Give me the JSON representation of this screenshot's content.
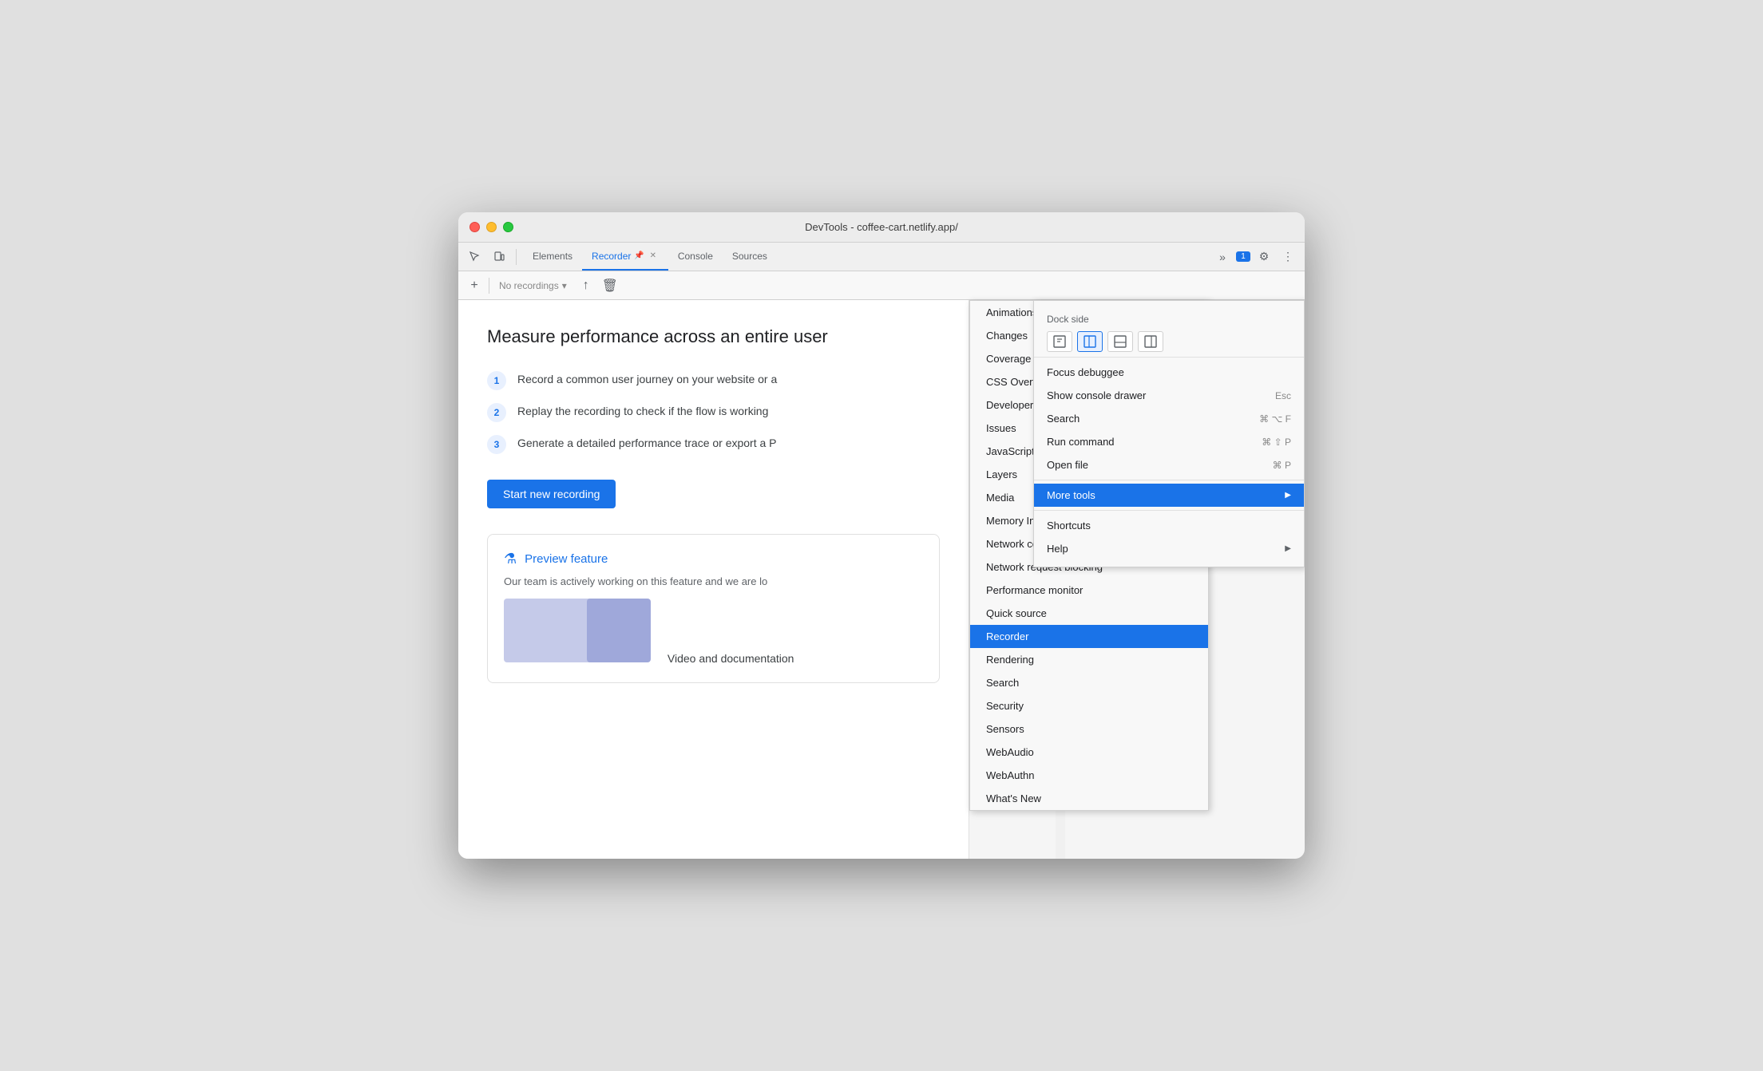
{
  "window": {
    "title": "DevTools - coffee-cart.netlify.app/"
  },
  "traffic_lights": {
    "red_label": "close",
    "yellow_label": "minimize",
    "green_label": "maximize"
  },
  "toolbar": {
    "tabs": [
      {
        "id": "elements",
        "label": "Elements",
        "active": false
      },
      {
        "id": "recorder",
        "label": "Recorder",
        "active": true,
        "has_pin": true,
        "has_close": true
      },
      {
        "id": "console",
        "label": "Console",
        "active": false
      },
      {
        "id": "sources",
        "label": "Sources",
        "active": false
      }
    ],
    "more_tabs_icon": "»",
    "badge_count": "1",
    "settings_icon": "⚙",
    "more_icon": "⋮"
  },
  "recordings_bar": {
    "add_button": "+",
    "dropdown_label": "No recordings",
    "upload_icon": "↑",
    "delete_icon": "🗑"
  },
  "recorder_panel": {
    "heading": "Measure performance across an entire user",
    "steps": [
      {
        "number": "1",
        "text": "Record a common user journey on your website or a"
      },
      {
        "number": "2",
        "text": "Replay the recording to check if the flow is working"
      },
      {
        "number": "3",
        "text": "Generate a detailed performance trace or export a P"
      }
    ],
    "start_button": "Start new recording",
    "preview_feature": {
      "title": "Preview feature",
      "text": "Our team is actively working on this feature and we are lo",
      "video_doc_label": "Video and documentation"
    }
  },
  "more_tools_menu": {
    "title": "More tools",
    "items": [
      {
        "label": "Animations",
        "active": false
      },
      {
        "label": "Changes",
        "active": false
      },
      {
        "label": "Coverage",
        "active": false
      },
      {
        "label": "CSS Overview",
        "active": false
      },
      {
        "label": "Developer Resources",
        "active": false
      },
      {
        "label": "Issues",
        "active": false
      },
      {
        "label": "JavaScript Profiler",
        "active": false
      },
      {
        "label": "Layers",
        "active": false
      },
      {
        "label": "Media",
        "active": false
      },
      {
        "label": "Memory Inspector",
        "active": false
      },
      {
        "label": "Network conditions",
        "active": false
      },
      {
        "label": "Network request blocking",
        "active": false
      },
      {
        "label": "Performance monitor",
        "active": false
      },
      {
        "label": "Quick source",
        "active": false
      },
      {
        "label": "Recorder",
        "active": true
      },
      {
        "label": "Rendering",
        "active": false
      },
      {
        "label": "Search",
        "active": false
      },
      {
        "label": "Security",
        "active": false
      },
      {
        "label": "Sensors",
        "active": false
      },
      {
        "label": "WebAudio",
        "active": false
      },
      {
        "label": "WebAuthn",
        "active": false
      },
      {
        "label": "What's New",
        "active": false
      }
    ]
  },
  "devtools_menu": {
    "dock_side_label": "Dock side",
    "dock_icons": [
      {
        "id": "undock",
        "symbol": "⬜",
        "selected": false
      },
      {
        "id": "dock-left",
        "symbol": "▣",
        "selected": true
      },
      {
        "id": "dock-bottom",
        "symbol": "⬛",
        "selected": false
      },
      {
        "id": "dock-right",
        "symbol": "▤",
        "selected": false
      }
    ],
    "items": [
      {
        "label": "Focus debuggee",
        "shortcut": "",
        "has_arrow": false
      },
      {
        "label": "Show console drawer",
        "shortcut": "Esc",
        "has_arrow": false
      },
      {
        "label": "Search",
        "shortcut": "⌘ ⌥ F",
        "has_arrow": false
      },
      {
        "label": "Run command",
        "shortcut": "⌘ ⇧ P",
        "has_arrow": false
      },
      {
        "label": "Open file",
        "shortcut": "⌘ P",
        "has_arrow": false
      },
      {
        "label": "More tools",
        "shortcut": "",
        "has_arrow": true,
        "active": true
      },
      {
        "label": "Shortcuts",
        "shortcut": "",
        "has_arrow": false
      },
      {
        "label": "Help",
        "shortcut": "",
        "has_arrow": true
      }
    ]
  }
}
